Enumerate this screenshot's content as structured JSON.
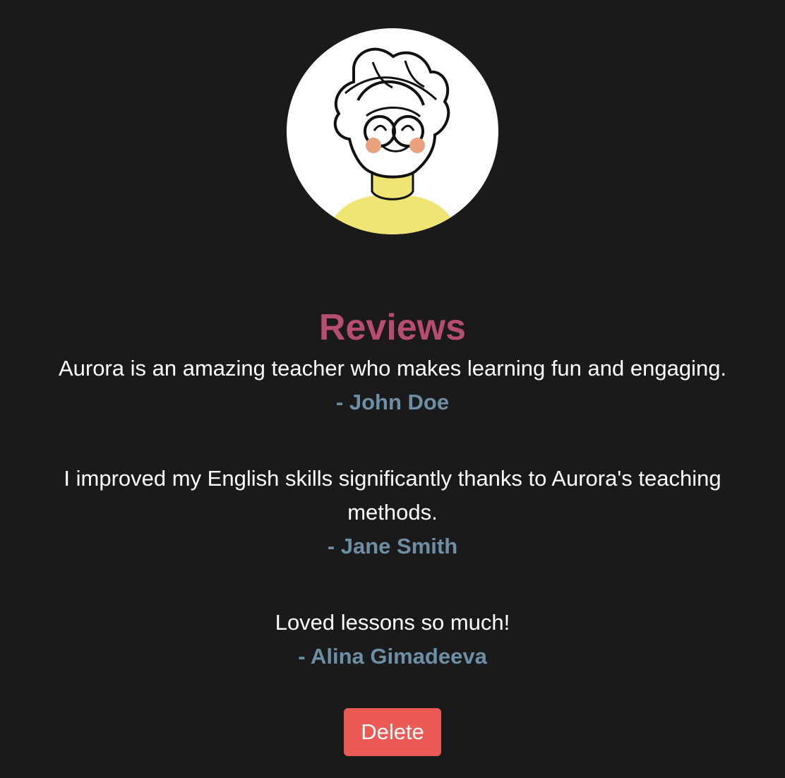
{
  "avatar": {
    "icon": "cartoon-teacher-avatar-icon"
  },
  "reviews": {
    "title": "Reviews",
    "items": [
      {
        "text": "Aurora is an amazing teacher who makes learning fun and engaging.",
        "author": "- John Doe"
      },
      {
        "text": "I improved my English skills significantly thanks to Aurora's teaching methods.",
        "author": "- Jane Smith"
      },
      {
        "text": "Loved lessons so much!",
        "author": "- Alina Gimadeeva"
      }
    ]
  },
  "actions": {
    "delete_label": "Delete"
  },
  "colors": {
    "background": "#1a1a1a",
    "title": "#b84d72",
    "author": "#6d8fa6",
    "delete_button": "#eb5a55"
  }
}
